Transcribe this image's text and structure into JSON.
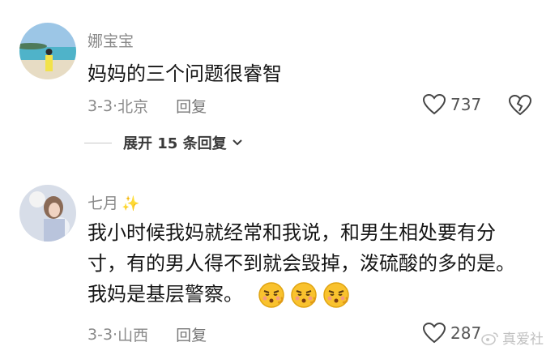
{
  "comments": [
    {
      "username": "娜宝宝",
      "text_lines": [
        "妈妈的三个问题很睿智"
      ],
      "date": "3-3",
      "location": "北京",
      "reply_label": "回复",
      "likes": "737"
    },
    {
      "username": "七月",
      "username_suffix": "✨",
      "text_lines": [
        "我小时候我妈就经常和我说，和男生相处要有分",
        "寸，有的男人得不到就会毁掉，泼硫酸的多的是。",
        "我妈是基层警察。"
      ],
      "date": "3-3",
      "location": "山西",
      "reply_label": "回复",
      "likes": "287"
    }
  ],
  "expand_replies": {
    "label": "展开 15 条回复"
  },
  "watermark": {
    "text": "真爱社"
  },
  "colors": {
    "meta": "#8a8a8a",
    "text": "#161616",
    "background": "#ffffff"
  }
}
